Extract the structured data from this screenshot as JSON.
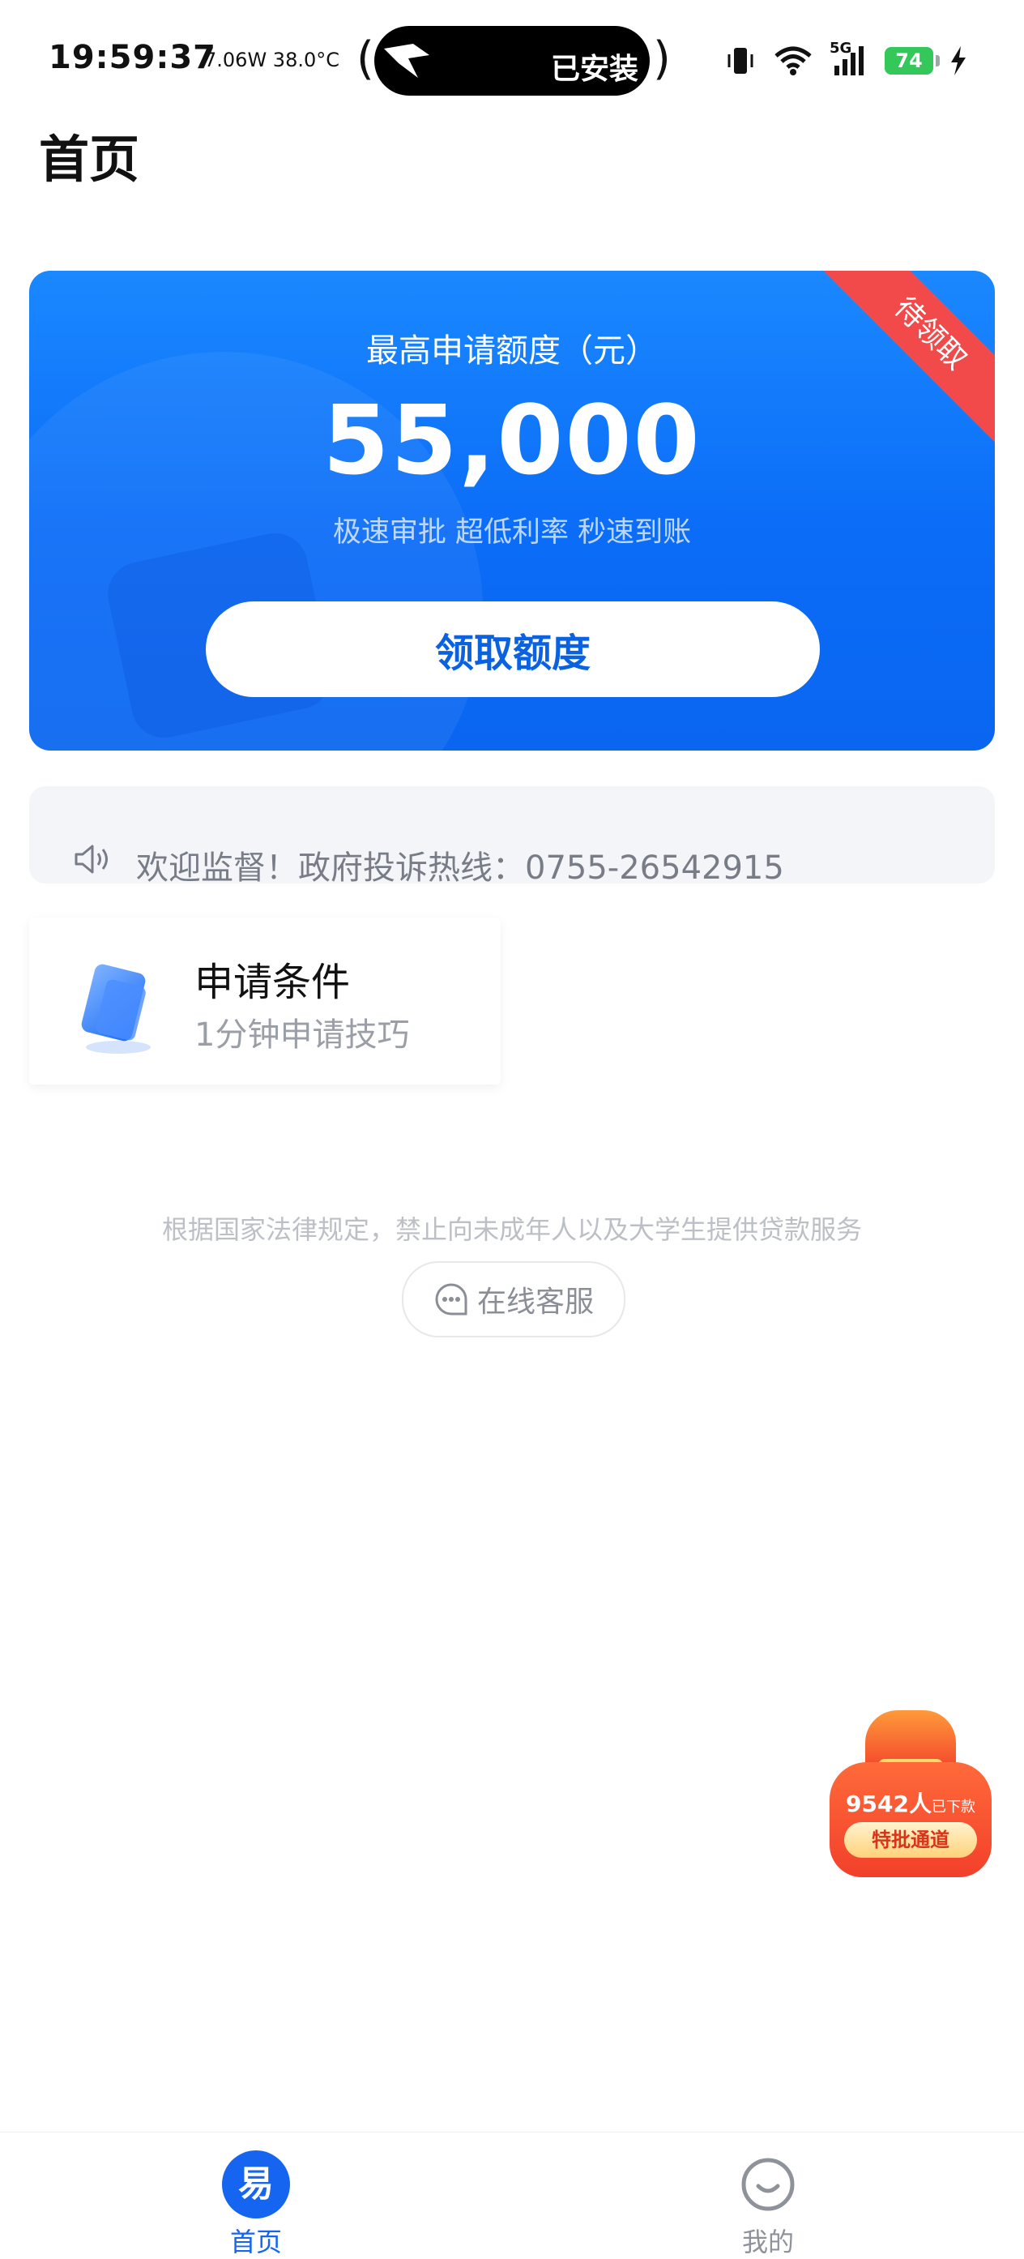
{
  "status_bar": {
    "time": "19:59:37",
    "info": "7.06W 38.0°C",
    "island_text": "已安装",
    "network": "5G",
    "battery": "74"
  },
  "page": {
    "title": "首页"
  },
  "hero": {
    "label": "最高申请额度（元）",
    "amount": "55,000",
    "features": "极速审批 超低利率 秒速到账",
    "button": "领取额度",
    "ribbon": "待领取"
  },
  "notice": {
    "text": "欢迎监督！政府投诉热线：0755-26542915"
  },
  "conditions": {
    "title": "申请条件",
    "subtitle": "1分钟申请技巧"
  },
  "disclaimer": "根据国家法律规定，禁止向未成年人以及大学生提供贷款服务",
  "customer_service": {
    "label": "在线客服"
  },
  "promo": {
    "count": "9542人",
    "count_suffix": "已下款",
    "button": "特批通道"
  },
  "tabbar": {
    "items": [
      {
        "label": "首页",
        "icon_char": "易",
        "icon": "home-logo-icon",
        "active": true
      },
      {
        "label": "我的",
        "icon": "smile-face-icon",
        "active": false
      }
    ]
  },
  "colors": {
    "primary": "#0b6cf7",
    "ribbon": "#f24a4a",
    "battery": "#34c759"
  }
}
